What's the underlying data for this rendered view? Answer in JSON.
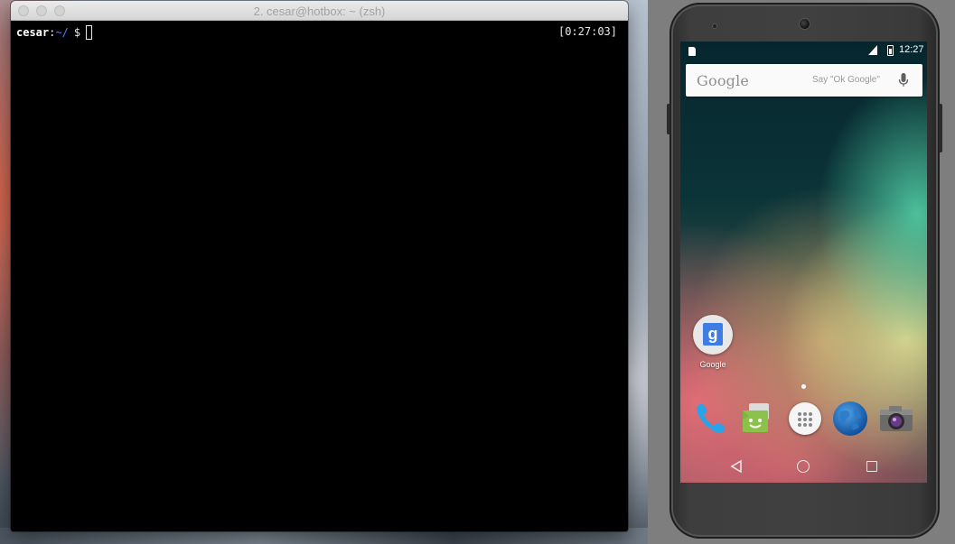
{
  "terminal": {
    "window_title": "2. cesar@hotbox: ~ (zsh)",
    "prompt_user": "cesar",
    "prompt_sep": ":",
    "prompt_path": "~/",
    "prompt_symbol": "$",
    "right_prompt": "[0:27:03]"
  },
  "phone": {
    "status_time": "12:27",
    "search_widget": {
      "logo": "Google",
      "hint": "Say \"Ok Google\""
    },
    "home_apps": [
      {
        "label": "Google",
        "icon": "google-search-icon"
      }
    ],
    "dock": [
      {
        "icon": "phone-icon"
      },
      {
        "icon": "messenger-icon"
      },
      {
        "icon": "app-launcher-icon"
      },
      {
        "icon": "browser-icon"
      },
      {
        "icon": "camera-icon"
      }
    ],
    "nav": [
      "back-icon",
      "home-icon",
      "recents-icon"
    ]
  },
  "colors": {
    "prompt_path": "#5a7bff",
    "search_bg": "#fafafa",
    "terminal_bg": "#000000"
  }
}
